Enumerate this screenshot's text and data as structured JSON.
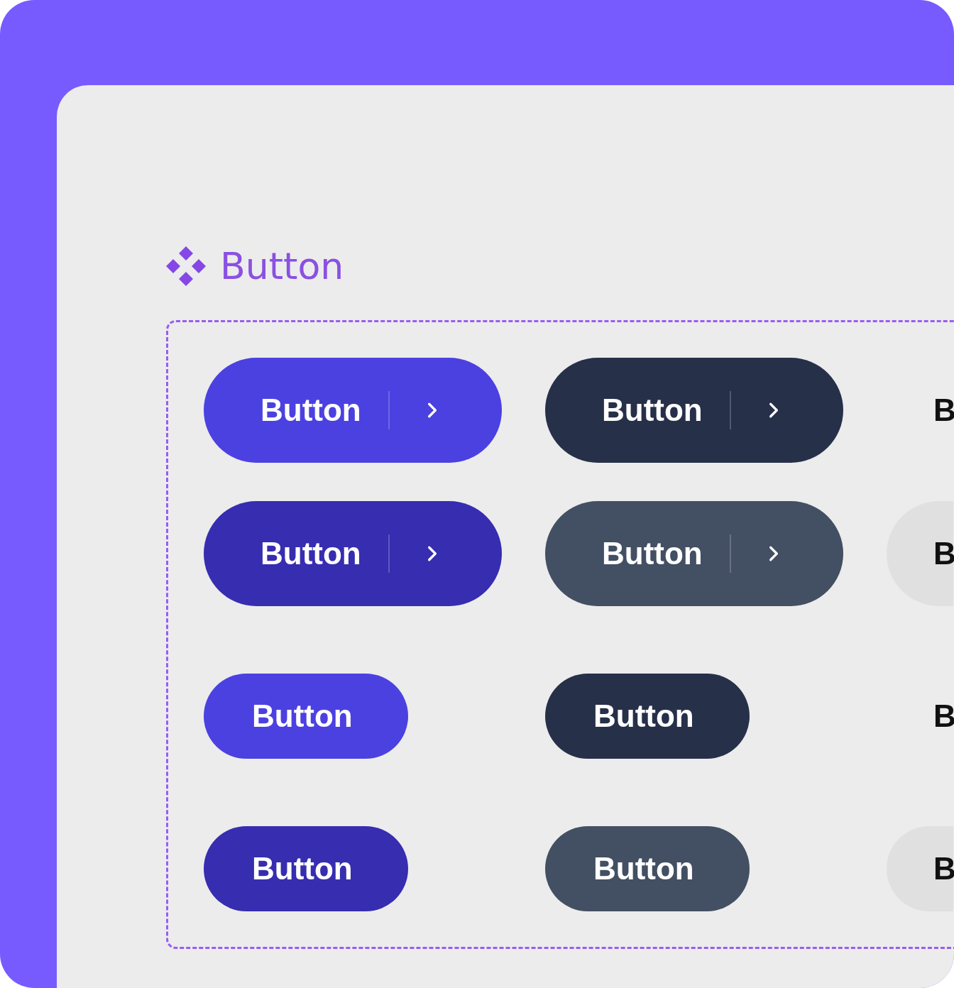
{
  "component": {
    "title": "Button"
  },
  "rows": [
    {
      "kind": "large",
      "buttons": [
        {
          "kind": "primary",
          "label": "Button",
          "chevron": true
        },
        {
          "kind": "dark",
          "label": "Button",
          "chevron": true
        },
        {
          "kind": "ghost",
          "label": "B"
        }
      ]
    },
    {
      "kind": "large",
      "buttons": [
        {
          "kind": "primary-pressed",
          "label": "Button",
          "chevron": true
        },
        {
          "kind": "dark-hover",
          "label": "Button",
          "chevron": true
        },
        {
          "kind": "ghost-hover",
          "label": "B"
        }
      ]
    },
    {
      "kind": "small",
      "buttons": [
        {
          "kind": "primary",
          "label": "Button"
        },
        {
          "kind": "dark",
          "label": "Button"
        },
        {
          "kind": "ghost",
          "label": "B"
        }
      ]
    },
    {
      "kind": "small",
      "buttons": [
        {
          "kind": "primary-pressed",
          "label": "Button"
        },
        {
          "kind": "dark-hover",
          "label": "Button"
        },
        {
          "kind": "ghost-hover",
          "label": "B"
        }
      ]
    }
  ]
}
